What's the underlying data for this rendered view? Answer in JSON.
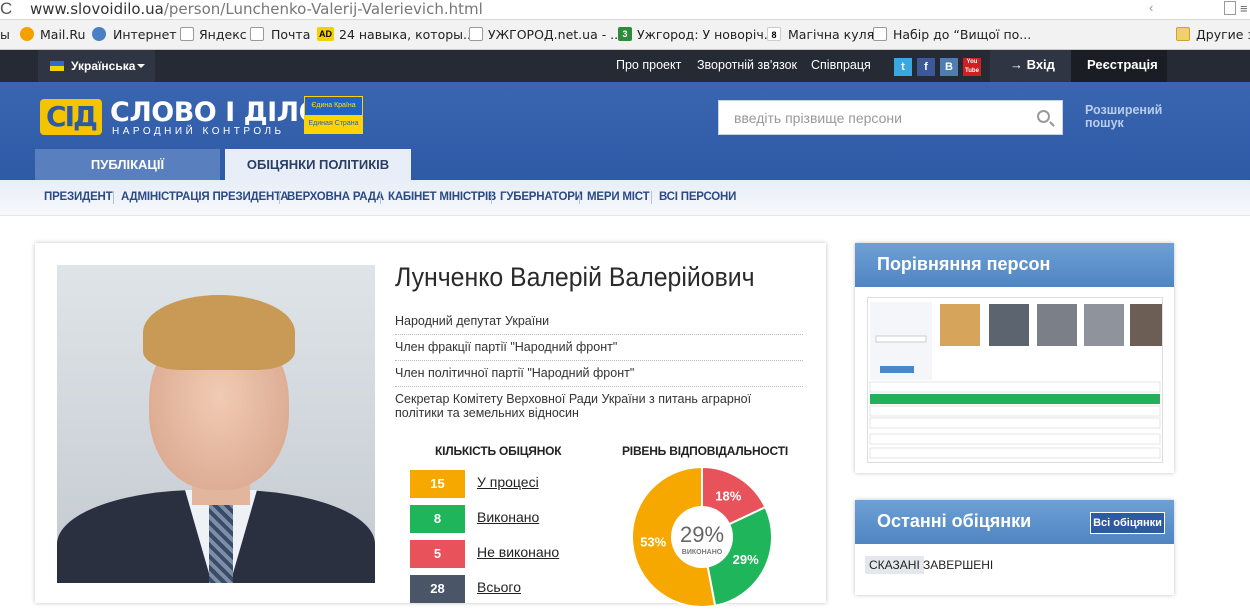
{
  "browser": {
    "url_domain": "www.slovoidilo.ua",
    "url_path": "/person/Lunchenko-Valerij-Valerievich.html",
    "bookmarks": [
      "ы",
      "Mail.Ru",
      "Интернет",
      "Яндекс",
      "Почта",
      "24 навыка, которы...",
      "УЖГОРОД.net.ua - ...",
      "Ужгород: У новоріч...",
      "Магічна куля",
      "Набір до “Вищої по...",
      "Другие за"
    ],
    "bookmark_icons": [
      "AD",
      "3",
      "8"
    ]
  },
  "topbar": {
    "language": "Українська",
    "links": [
      "Про проект",
      "Зворотній зв'язок",
      "Співпраця"
    ],
    "social": [
      "t",
      "f",
      "B",
      "You Tube"
    ],
    "login": "→ Вхід",
    "register": "Реєстрація"
  },
  "header": {
    "logo_mark": "СІД",
    "logo_title": "СЛОВО І ДІЛО",
    "logo_subtitle": "НАРОДНИЙ КОНТРОЛЬ",
    "badge_top": "Єдина Країна",
    "badge_bottom": "Единая Страна",
    "search_placeholder": "введіть прізвище персони",
    "advanced_search": "Розширений пошук",
    "tabs": [
      "ПУБЛІКАЦІЇ",
      "ОБІЦЯНКИ ПОЛІТИКІВ"
    ]
  },
  "subnav": [
    "ПРЕЗИДЕНТ",
    "АДМІНІСТРАЦІЯ ПРЕЗИДЕНТА",
    "ВЕРХОВНА РАДА",
    "КАБІНЕТ МІНІСТРІВ",
    "ГУБЕРНАТОРИ",
    "МЕРИ МІСТ",
    "ВСІ ПЕРСОНИ"
  ],
  "person": {
    "name": "Лунченко Валерій Валерійович",
    "positions": [
      "Народний депутат України",
      "Член фракції партії \"Народний фронт\"",
      "Член політичної партії \"Народний фронт\"",
      "Секретар Комітету Верховної Ради України з питань аграрної політики та земельних відносин"
    ]
  },
  "stats": {
    "count_title": "КІЛЬКІСТЬ ОБІЦЯНОК",
    "resp_title": "РІВЕНЬ ВІДПОВІДАЛЬНОСТІ",
    "items": [
      {
        "count": "15",
        "label": "У процесі",
        "color": "#f6a800"
      },
      {
        "count": "8",
        "label": "Виконано",
        "color": "#1fb55a"
      },
      {
        "count": "5",
        "label": "Не виконано",
        "color": "#e8525a"
      },
      {
        "count": "28",
        "label": "Всього",
        "color": "#4a5568"
      }
    ]
  },
  "chart_data": {
    "type": "pie",
    "center_value": "29%",
    "center_label": "ВИКОНАНО",
    "slices": [
      {
        "label": "53%",
        "value": 53,
        "color": "#f6a800"
      },
      {
        "label": "18%",
        "value": 18,
        "color": "#e8525a"
      },
      {
        "label": "29%",
        "value": 29,
        "color": "#1fb55a"
      }
    ]
  },
  "compare": {
    "title": "Порівняння персон"
  },
  "last": {
    "title": "Останні обіцянки",
    "all_button": "Всі обіцянки",
    "filters": [
      "СКАЗАНІ",
      "ЗАВЕРШЕНІ"
    ]
  }
}
